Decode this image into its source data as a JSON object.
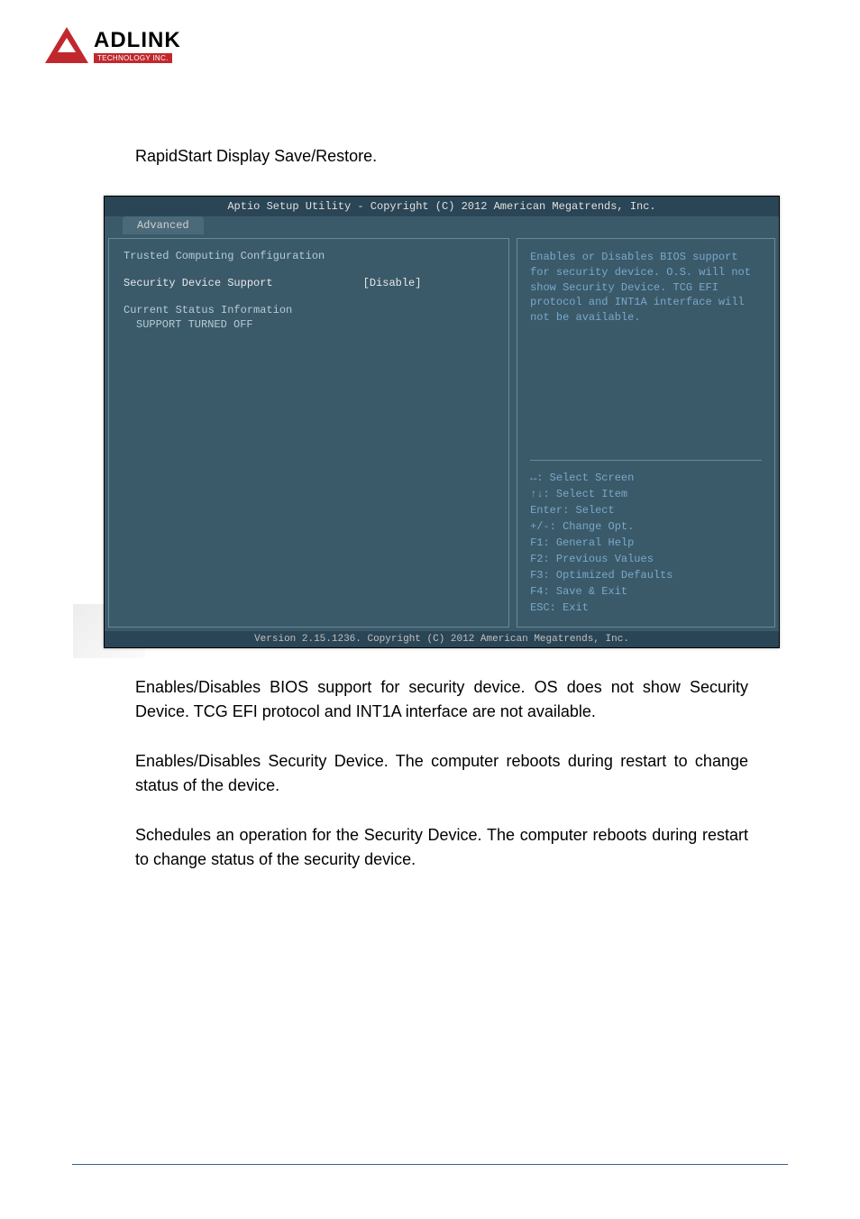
{
  "logo": {
    "main": "ADLINK",
    "sub": "TECHNOLOGY INC."
  },
  "paragraphs": {
    "p1": "RapidStart Display Save/Restore.",
    "p2": "Enables/Disables BIOS support for security device. OS does not show Security Device. TCG EFI protocol and INT1A interface are not available.",
    "p3": "Enables/Disables Security Device. The computer reboots during restart to change status of the device.",
    "p4": "Schedules an operation for the Security Device. The computer reboots during restart to change status of the security device."
  },
  "bios": {
    "header": "Aptio Setup Utility - Copyright (C) 2012 American Megatrends, Inc.",
    "tab": "Advanced",
    "left": {
      "title": "Trusted Computing Configuration",
      "setting_label": "Security Device Support",
      "setting_value": "[Disable]",
      "status_title": "Current Status Information",
      "status_line": "SUPPORT TURNED OFF"
    },
    "right_top": "Enables or Disables BIOS support for security device. O.S. will not show Security Device. TCG EFI protocol and INT1A interface will not be available.",
    "right_bottom": {
      "l1": "↔: Select Screen",
      "l2": "↑↓: Select Item",
      "l3": "Enter: Select",
      "l4": "+/-: Change Opt.",
      "l5": "F1: General Help",
      "l6": "F2: Previous Values",
      "l7": "F3: Optimized Defaults",
      "l8": "F4: Save & Exit",
      "l9": "ESC: Exit"
    },
    "footer": "Version 2.15.1236. Copyright (C) 2012 American Megatrends, Inc."
  }
}
